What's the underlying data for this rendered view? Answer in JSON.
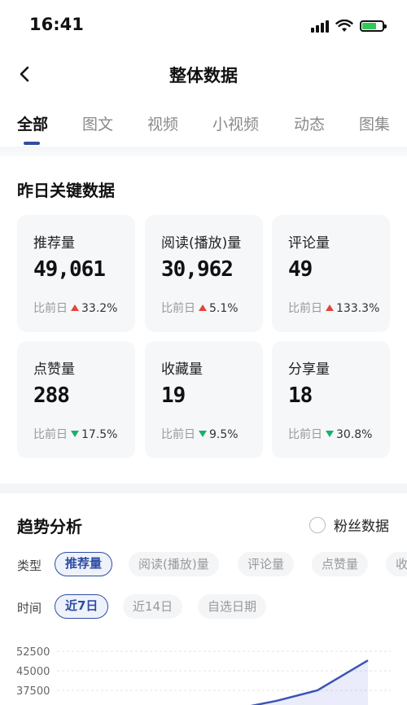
{
  "status_bar": {
    "time": "16:41"
  },
  "nav": {
    "title": "整体数据"
  },
  "tabs": [
    "全部",
    "图文",
    "视频",
    "小视频",
    "动态",
    "图集"
  ],
  "key_data": {
    "title": "昨日关键数据",
    "compare_label": "比前日",
    "cards": [
      {
        "label": "推荐量",
        "value": "49,061",
        "trend": "up",
        "pct": "33.2%"
      },
      {
        "label": "阅读(播放)量",
        "value": "30,962",
        "trend": "up",
        "pct": "5.1%"
      },
      {
        "label": "评论量",
        "value": "49",
        "trend": "up",
        "pct": "133.3%"
      },
      {
        "label": "点赞量",
        "value": "288",
        "trend": "down",
        "pct": "17.5%"
      },
      {
        "label": "收藏量",
        "value": "19",
        "trend": "down",
        "pct": "9.5%"
      },
      {
        "label": "分享量",
        "value": "18",
        "trend": "down",
        "pct": "30.8%"
      }
    ]
  },
  "trend": {
    "title": "趋势分析",
    "fans_label": "粉丝数据",
    "type_label": "类型",
    "type_chips": [
      "推荐量",
      "阅读(播放)量",
      "评论量",
      "点赞量",
      "收"
    ],
    "time_label": "时间",
    "time_chips": [
      "近7日",
      "近14日",
      "自选日期"
    ]
  },
  "colors": {
    "accent": "#2f4da3",
    "up": "#e0453c",
    "down": "#19b16a"
  },
  "chart_data": {
    "type": "line",
    "y_ticks": [
      "52500",
      "45000",
      "37500"
    ],
    "ylim": [
      30000,
      52500
    ],
    "series": [
      {
        "values": [
          31000,
          33500,
          37500,
          49000
        ]
      }
    ]
  }
}
